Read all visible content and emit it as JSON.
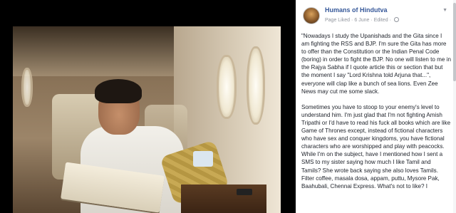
{
  "post": {
    "page_name": "Humans of Hindutva",
    "status": "Page Liked",
    "date": "6 June",
    "edited": "Edited",
    "avatar_icon": "page-avatar",
    "menu_icon": "chevron-down-icon",
    "paragraphs": [
      "\"Nowadays I study the Upanishads and the Gita since I am fighting the RSS and BJP. I'm sure the Gita has more to offer than the Constitution or the Indian Penal Code (boring) in order to fight the BJP. No one will listen to me in the Rajya Sabha if I quote article this or section that but the moment I say \"Lord Krishna told Arjuna that...\", everyone will clap like a bunch of sea lions. Even Zee News may cut me some slack.",
      "Sometimes you have to stoop to your enemy's level to understand him. I'm just glad that I'm not fighting Amish Tripathi or I'd have to read his fuck all books which are like Game of Thrones except, instead of fictional characters who have sex and conquer kingdoms, you have fictional characters who are worshipped and play with peacocks. While I'm on the subject, have I mentioned how I sent a SMS to my sister saying how much I like Tamil and Tamils? She wrote back saying she also loves Tamils. Filter coffee, masala dosa, appam, puttu, Mysore Pak, Baahubali, Chennai Express. What's not to like? I"
    ]
  },
  "colors": {
    "link": "#365899",
    "meta": "#90949c",
    "text": "#1d2129",
    "viewer_bg": "#000000"
  }
}
